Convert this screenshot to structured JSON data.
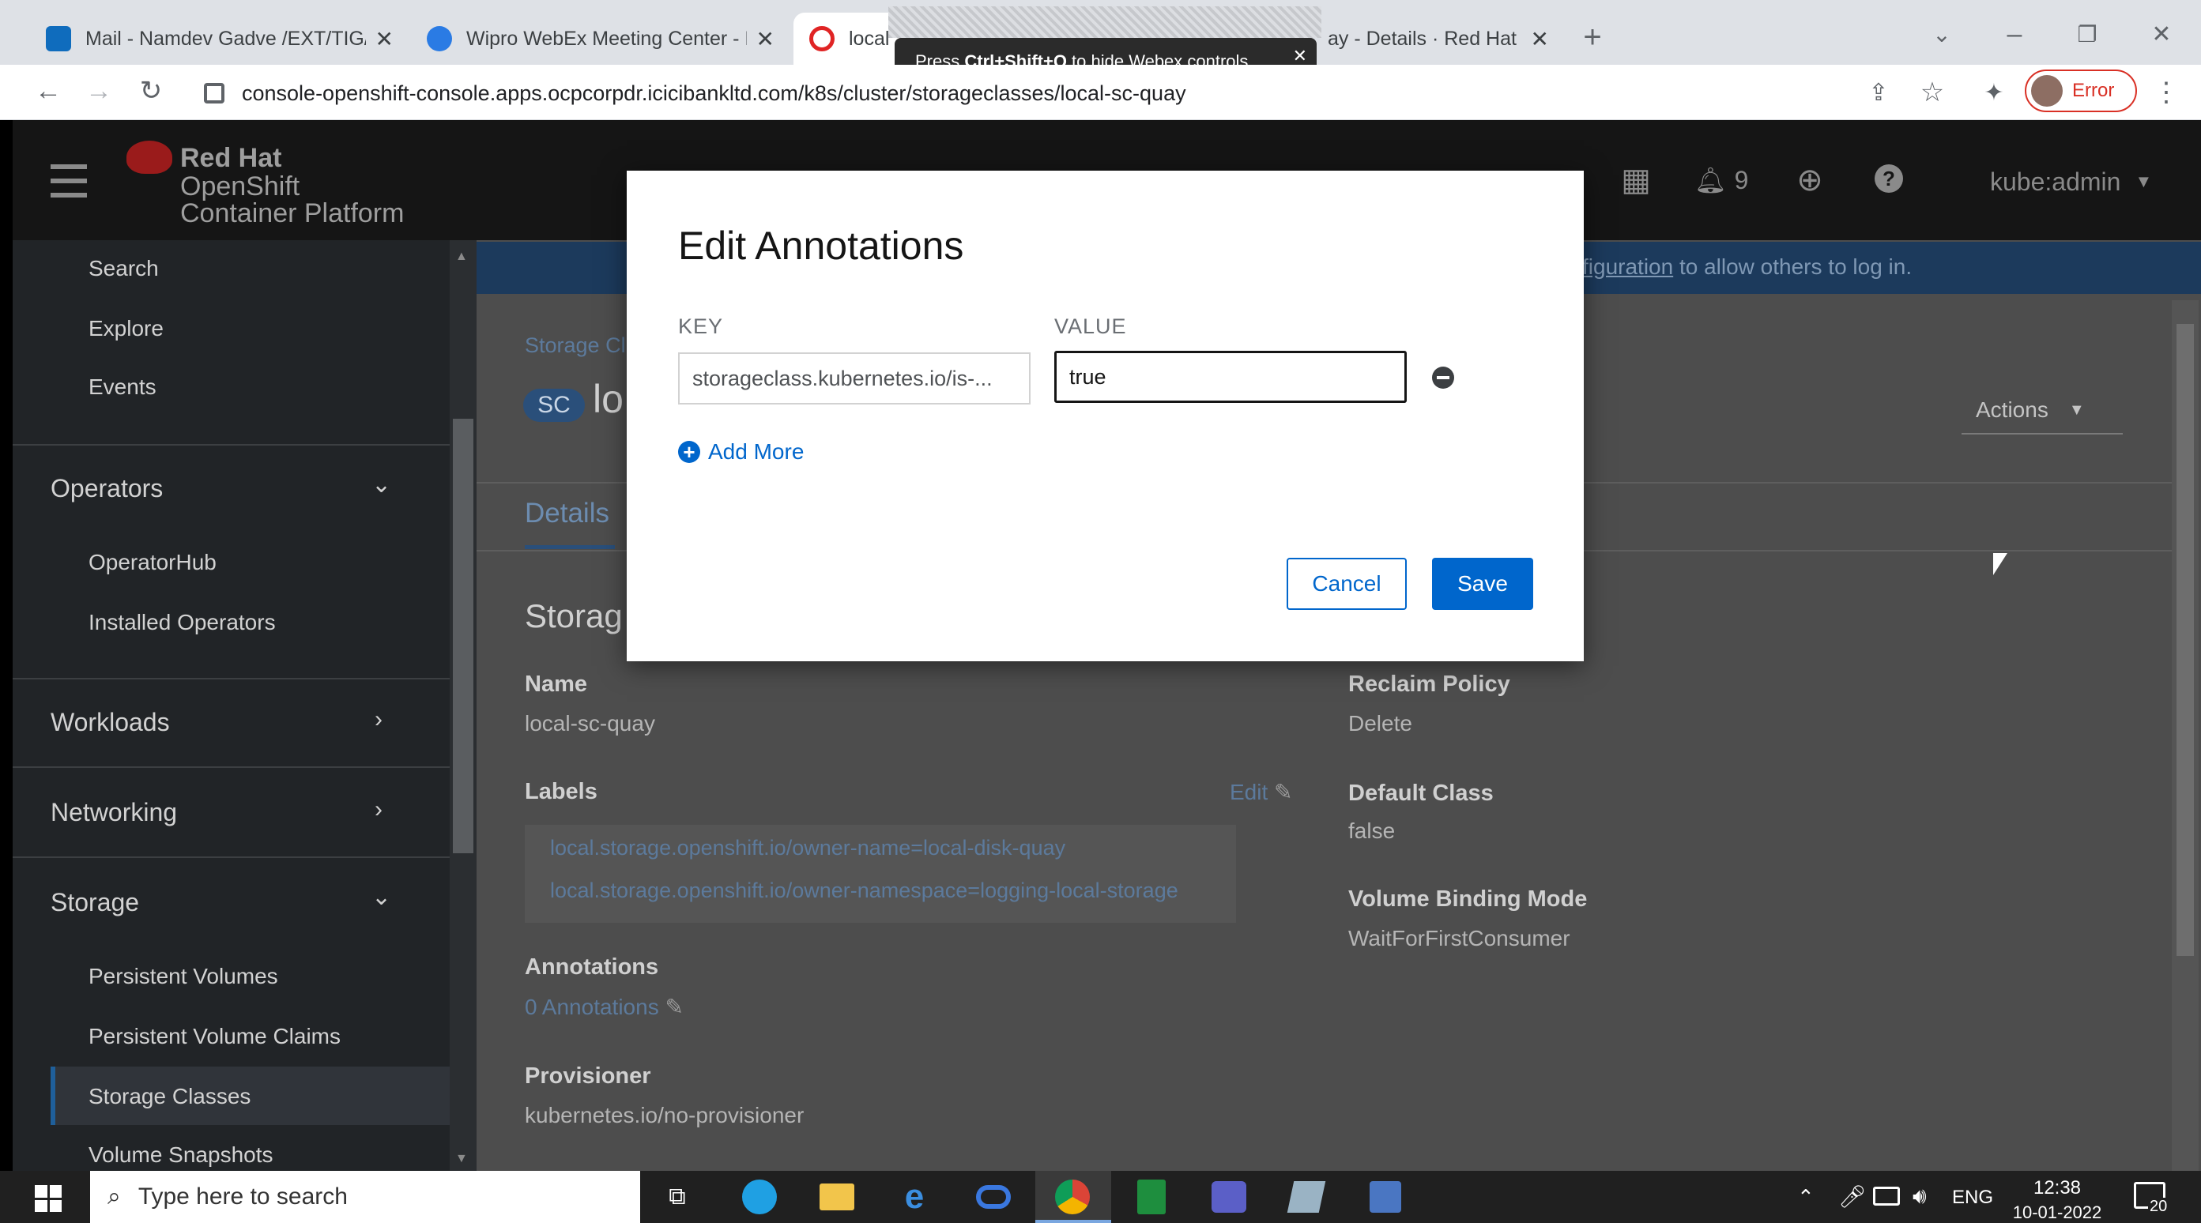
{
  "browser": {
    "tabs": [
      {
        "label": "Mail - Namdev Gadve /EXT/TIG/I",
        "color": "#0f6cbd"
      },
      {
        "label": "Wipro WebEx Meeting Center - F",
        "color": "#2a7be4"
      },
      {
        "label": "local",
        "color": "#e02424"
      },
      {
        "label": "ay - Details · Red Hat (",
        "color": "#c9190b"
      }
    ],
    "url": "console-openshift-console.apps.ocpcorpdr.icicibankltd.com/k8s/cluster/storageclasses/local-sc-quay",
    "profile_label": "Error",
    "webex_toast": {
      "prefix": "Press ",
      "keys": "Ctrl+Shift+Q",
      "suffix": " to hide Webex controls."
    }
  },
  "masthead": {
    "brand_line1": "Red Hat",
    "brand_line2": "OpenShift",
    "brand_line3": "Container Platform",
    "notification_count": "9",
    "user": "kube:admin"
  },
  "sidebar": {
    "items_top": [
      "Search",
      "Explore",
      "Events"
    ],
    "operators": {
      "title": "Operators",
      "items": [
        "OperatorHub",
        "Installed Operators"
      ]
    },
    "workloads": "Workloads",
    "networking": "Networking",
    "storage": {
      "title": "Storage",
      "items": [
        "Persistent Volumes",
        "Persistent Volume Claims",
        "Storage Classes",
        "Volume Snapshots"
      ],
      "active": "Storage Classes"
    }
  },
  "banner": {
    "link": "figuration",
    "text": " to allow others to log in."
  },
  "page": {
    "breadcrumb": "Storage Cl",
    "badge": "SC",
    "title": "lo",
    "actions": "Actions",
    "tab_details": "Details",
    "section_title": "Storag",
    "name_label": "Name",
    "name_value": "local-sc-quay",
    "labels_label": "Labels",
    "labels_edit": "Edit",
    "labels": [
      "local.storage.openshift.io/owner-name=local-disk-quay",
      "local.storage.openshift.io/owner-namespace=logging-local-storage"
    ],
    "annotations_label": "Annotations",
    "annotations_value": "0 Annotations",
    "provisioner_label": "Provisioner",
    "provisioner_value": "kubernetes.io/no-provisioner",
    "reclaim_label": "Reclaim Policy",
    "reclaim_value": "Delete",
    "default_label": "Default Class",
    "default_value": "false",
    "binding_label": "Volume Binding Mode",
    "binding_value": "WaitForFirstConsumer"
  },
  "modal": {
    "title": "Edit Annotations",
    "key_label": "KEY",
    "value_label": "VALUE",
    "key_value": "storageclass.kubernetes.io/is-...",
    "value_value": "true",
    "add_more": "Add More",
    "cancel": "Cancel",
    "save": "Save"
  },
  "taskbar": {
    "search_placeholder": "Type here to search",
    "lang": "ENG",
    "time": "12:38",
    "date": "10-01-2022",
    "notif": "20"
  }
}
